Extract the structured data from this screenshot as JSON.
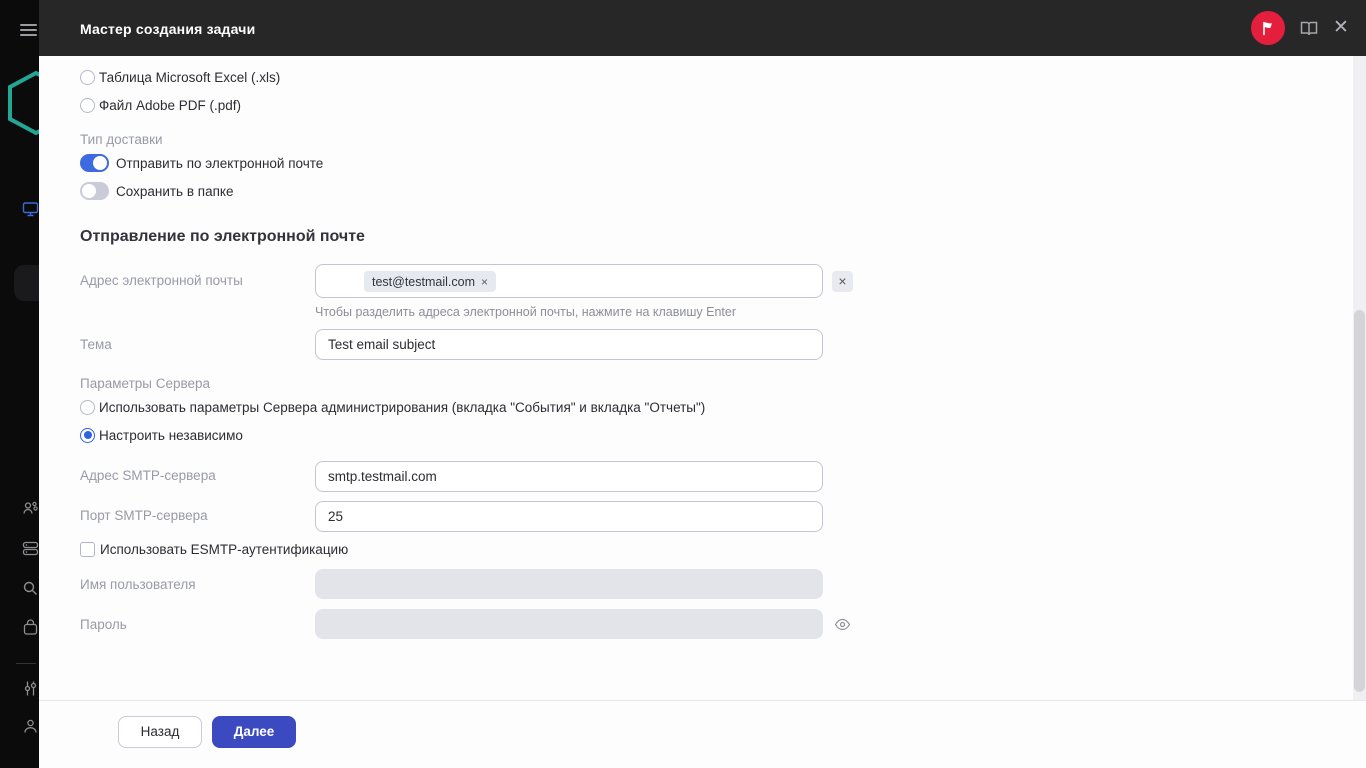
{
  "header": {
    "title": "Мастер создания задачи",
    "icons": {
      "badge": "flag-icon",
      "help": "book-icon",
      "close": "✕"
    }
  },
  "sidebar": {
    "icons": [
      "menu",
      "kaspersky-logo",
      "devices",
      "users",
      "repositories",
      "search",
      "marketplace",
      "settings",
      "account"
    ]
  },
  "content": {
    "report_format_options": [
      {
        "label": "Таблица Microsoft Excel (.xls)",
        "checked": false
      },
      {
        "label": "Файл Adobe PDF (.pdf)",
        "checked": false
      }
    ],
    "delivery": {
      "label": "Тип доставки",
      "toggles": [
        {
          "label": "Отправить по электронной почте",
          "on": true
        },
        {
          "label": "Сохранить в папке",
          "on": false
        }
      ]
    },
    "email_section": {
      "heading": "Отправление по электронной почте",
      "address": {
        "label": "Адрес электронной почты",
        "chip": "test@testmail.com",
        "chip_remove": "×",
        "clear": "×",
        "helper": "Чтобы разделить адреса электронной почты, нажмите на клавишу Enter"
      },
      "subject": {
        "label": "Тема",
        "value": "Test email subject"
      },
      "server_params": {
        "label": "Параметры Сервера",
        "options": [
          {
            "label": "Использовать параметры Сервера администрирования (вкладка \"События\" и вкладка \"Отчеты\")",
            "checked": false
          },
          {
            "label": "Настроить независимо",
            "checked": true
          }
        ]
      },
      "smtp_address": {
        "label": "Адрес SMTP-сервера",
        "value": "smtp.testmail.com"
      },
      "smtp_port": {
        "label": "Порт SMTP-сервера",
        "value": "25"
      },
      "esmtp": {
        "label": "Использовать ESMTP-аутентификацию",
        "checked": false
      },
      "username": {
        "label": "Имя пользователя",
        "value": ""
      },
      "password": {
        "label": "Пароль",
        "value": ""
      }
    }
  },
  "footer": {
    "back_label": "Назад",
    "next_label": "Далее"
  },
  "colors": {
    "accent_blue": "#3d6ae0",
    "radio_blue": "#2f63de",
    "next_button": "#3b4ac1",
    "badge_red": "#e41f3d",
    "logo_teal": "#23a794",
    "header_dark": "#272727",
    "sidebar_dark": "#0b0b0c"
  }
}
